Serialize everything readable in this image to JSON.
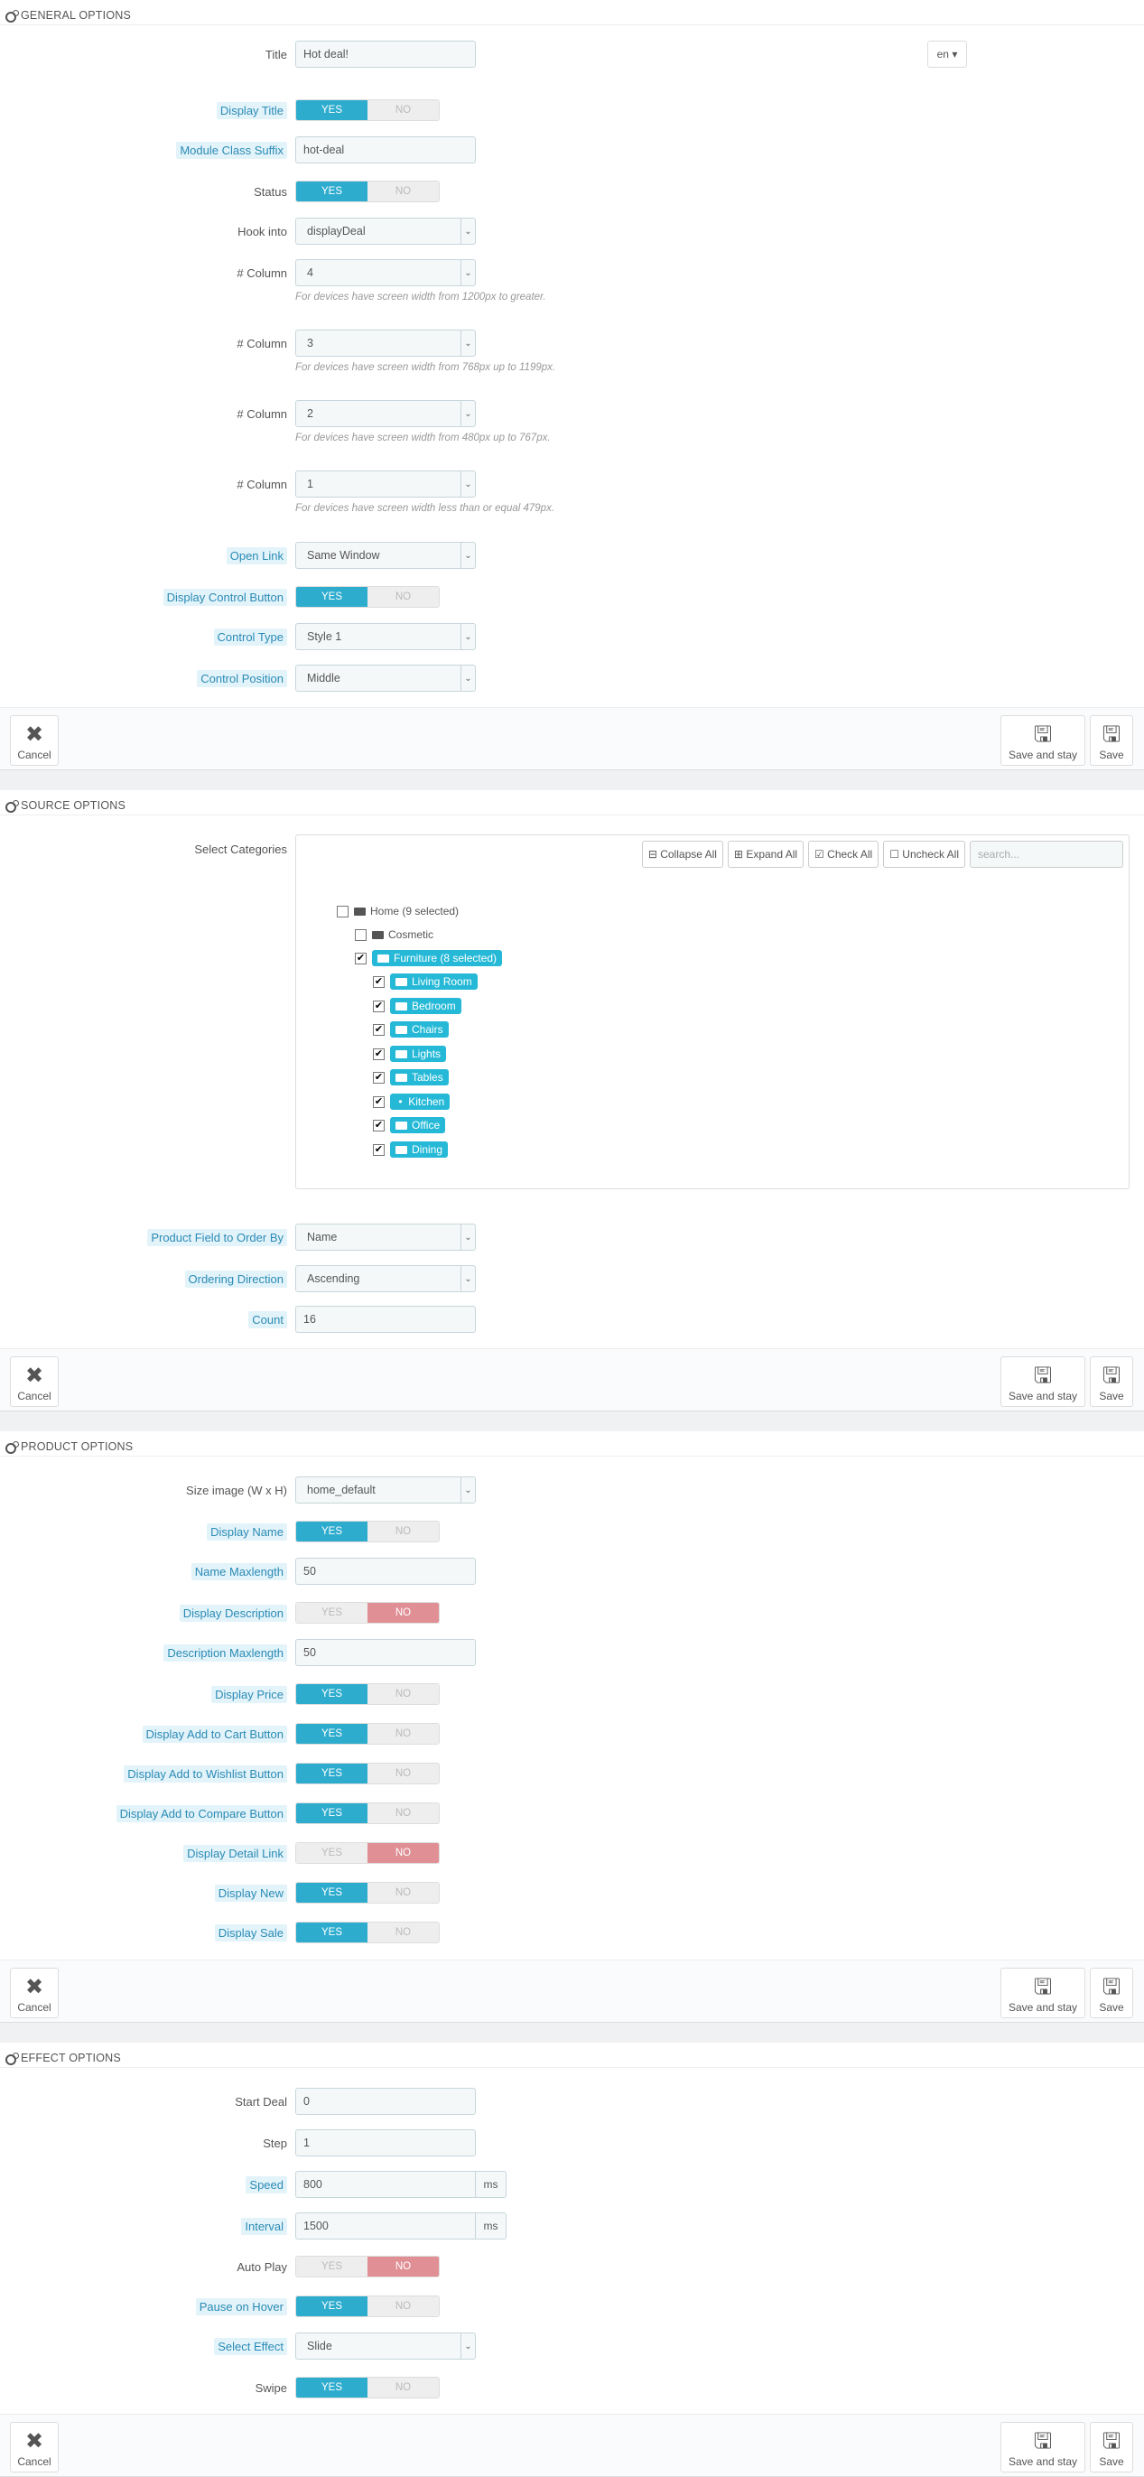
{
  "general": {
    "heading": "GENERAL OPTIONS",
    "title_label": "Title",
    "title_value": "Hot deal!",
    "lang": "en",
    "display_title_label": "Display Title",
    "module_class_label": "Module Class Suffix",
    "module_class_value": "hot-deal",
    "status_label": "Status",
    "hook_label": "Hook into",
    "hook_value": "displayDeal",
    "col_label": "# Column",
    "col1_value": "4",
    "col1_hint": "For devices have screen width from 1200px to greater.",
    "col2_value": "3",
    "col2_hint": "For devices have screen width from 768px up to 1199px.",
    "col3_value": "2",
    "col3_hint": "For devices have screen width from 480px up to 767px.",
    "col4_value": "1",
    "col4_hint": "For devices have screen width less than or equal 479px.",
    "open_link_label": "Open Link",
    "open_link_value": "Same Window",
    "display_control_label": "Display Control Button",
    "control_type_label": "Control Type",
    "control_type_value": "Style 1",
    "control_position_label": "Control Position",
    "control_position_value": "Middle"
  },
  "switch": {
    "yes": "YES",
    "no": "NO"
  },
  "footer": {
    "cancel": "Cancel",
    "save_stay": "Save and stay",
    "save": "Save"
  },
  "source": {
    "heading": "SOURCE OPTIONS",
    "select_categories_label": "Select Categories",
    "collapse_all": "Collapse All",
    "expand_all": "Expand All",
    "check_all": "Check All",
    "uncheck_all": "Uncheck All",
    "search_placeholder": "search...",
    "tree": {
      "home": "Home (9 selected)",
      "cosmetic": "Cosmetic",
      "furniture": "Furniture (8 selected)",
      "children": [
        "Living Room",
        "Bedroom",
        "Chairs",
        "Lights",
        "Tables",
        "Kitchen",
        "Office",
        "Dining"
      ]
    },
    "order_by_label": "Product Field to Order By",
    "order_by_value": "Name",
    "ordering_label": "Ordering Direction",
    "ordering_value": "Ascending",
    "count_label": "Count",
    "count_value": "16"
  },
  "product": {
    "heading": "PRODUCT OPTIONS",
    "size_label": "Size image (W x H)",
    "size_value": "home_default",
    "display_name_label": "Display Name",
    "name_max_label": "Name Maxlength",
    "name_max_value": "50",
    "display_desc_label": "Display Description",
    "desc_max_label": "Description Maxlength",
    "desc_max_value": "50",
    "display_price_label": "Display Price",
    "add_cart_label": "Display Add to Cart Button",
    "add_wishlist_label": "Display Add to Wishlist Button",
    "add_compare_label": "Display Add to Compare Button",
    "detail_link_label": "Display Detail Link",
    "display_new_label": "Display New",
    "display_sale_label": "Display Sale"
  },
  "effect": {
    "heading": "EFFECT OPTIONS",
    "start_deal_label": "Start Deal",
    "start_deal_value": "0",
    "step_label": "Step",
    "step_value": "1",
    "speed_label": "Speed",
    "speed_value": "800",
    "interval_label": "Interval",
    "interval_value": "1500",
    "unit": "ms",
    "autoplay_label": "Auto Play",
    "pause_label": "Pause on Hover",
    "select_effect_label": "Select Effect",
    "select_effect_value": "Slide",
    "swipe_label": "Swipe"
  }
}
